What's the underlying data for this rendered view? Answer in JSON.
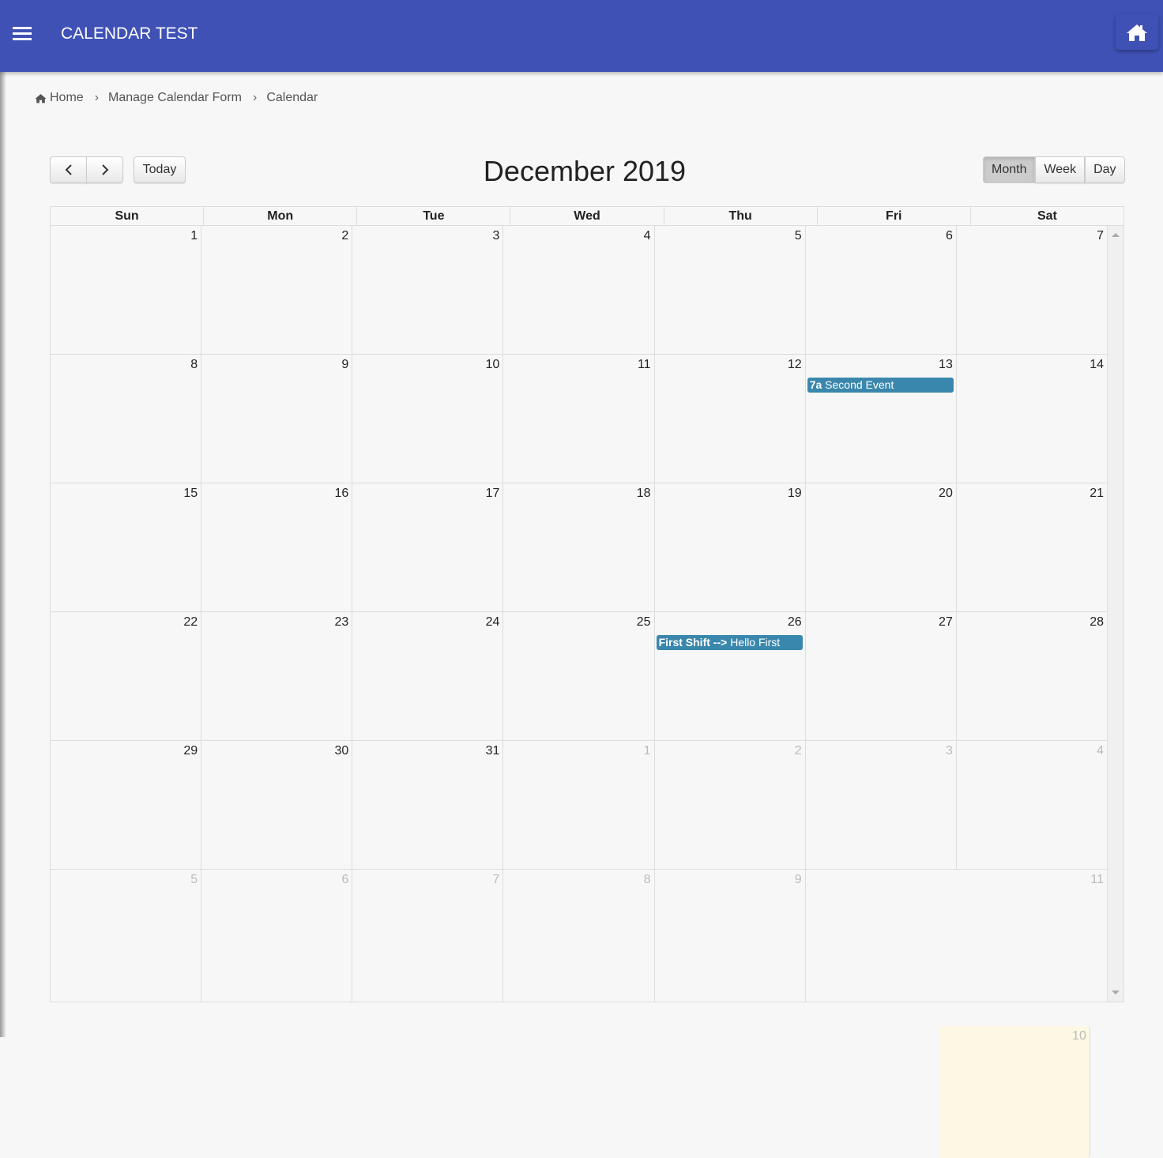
{
  "app": {
    "title": "CALENDAR TEST"
  },
  "breadcrumb": [
    "Home",
    "Manage Calendar Form",
    "Calendar"
  ],
  "toolbar": {
    "prev": "<",
    "next": ">",
    "today": "Today",
    "title": "December 2019",
    "views": [
      "Month",
      "Week",
      "Day"
    ],
    "active_view": "Month"
  },
  "days_of_week": [
    "Sun",
    "Mon",
    "Tue",
    "Wed",
    "Thu",
    "Fri",
    "Sat"
  ],
  "weeks": [
    [
      {
        "d": "1"
      },
      {
        "d": "2"
      },
      {
        "d": "3"
      },
      {
        "d": "4"
      },
      {
        "d": "5"
      },
      {
        "d": "6"
      },
      {
        "d": "7"
      }
    ],
    [
      {
        "d": "8"
      },
      {
        "d": "9"
      },
      {
        "d": "10"
      },
      {
        "d": "11"
      },
      {
        "d": "12"
      },
      {
        "d": "13",
        "event": {
          "time": "7a",
          "title": "Second Event"
        }
      },
      {
        "d": "14"
      }
    ],
    [
      {
        "d": "15"
      },
      {
        "d": "16"
      },
      {
        "d": "17"
      },
      {
        "d": "18"
      },
      {
        "d": "19"
      },
      {
        "d": "20"
      },
      {
        "d": "21"
      }
    ],
    [
      {
        "d": "22"
      },
      {
        "d": "23"
      },
      {
        "d": "24"
      },
      {
        "d": "25"
      },
      {
        "d": "26",
        "event": {
          "time": "First Shift -->",
          "title": "Hello First"
        }
      },
      {
        "d": "27"
      },
      {
        "d": "28"
      }
    ],
    [
      {
        "d": "29"
      },
      {
        "d": "30"
      },
      {
        "d": "31"
      },
      {
        "d": "1",
        "other": true
      },
      {
        "d": "2",
        "other": true
      },
      {
        "d": "3",
        "other": true
      },
      {
        "d": "4",
        "other": true
      }
    ],
    [
      {
        "d": "5",
        "other": true
      },
      {
        "d": "6",
        "other": true
      },
      {
        "d": "7",
        "other": true
      },
      {
        "d": "8",
        "other": true
      },
      {
        "d": "9",
        "other": true
      },
      {
        "d": "10",
        "other": true,
        "today": true
      },
      {
        "d": "11",
        "other": true
      }
    ]
  ],
  "colors": {
    "header": "#3f51b5",
    "event": "#3a87ad",
    "today": "#fcf8e3"
  }
}
